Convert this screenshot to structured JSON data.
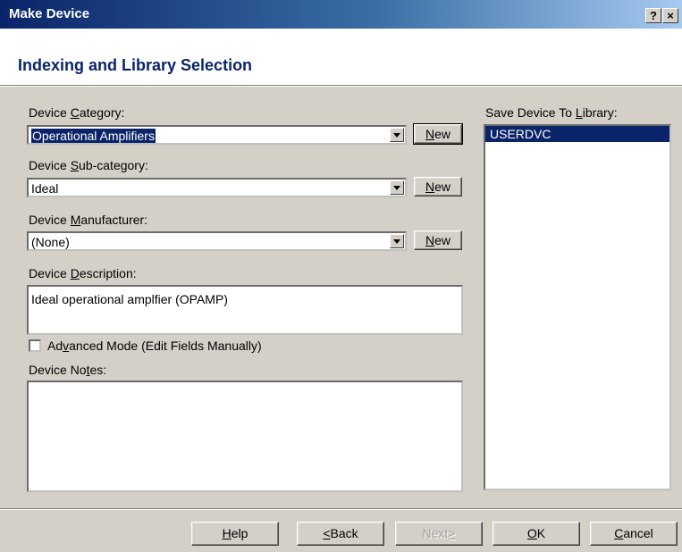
{
  "window": {
    "title": "Make Device",
    "help_btn": "?",
    "close_btn": "×"
  },
  "header": {
    "title": "Indexing and Library Selection"
  },
  "category": {
    "label": "Device Category:",
    "value": "Operational Amplifiers",
    "new_label": "New"
  },
  "subcategory": {
    "label": "Device Sub-category:",
    "value": "Ideal",
    "new_label": "New"
  },
  "manufacturer": {
    "label": "Device Manufacturer:",
    "value": "(None)",
    "new_label": "New"
  },
  "description": {
    "label": "Device Description:",
    "value": "Ideal operational amplfier (OPAMP)"
  },
  "advanced": {
    "label": "Advanced Mode (Edit Fields Manually)",
    "checked": false
  },
  "notes": {
    "label": "Device Notes:",
    "value": ""
  },
  "library": {
    "label": "Save Device To Library:",
    "items": [
      "USERDVC"
    ]
  },
  "buttons": {
    "help": "Help",
    "back": "<Back",
    "next": "Next>",
    "ok": "OK",
    "cancel": "Cancel"
  },
  "colors": {
    "title_bar": "#0a246a",
    "header_text": "#0a246a",
    "selection": "#0a246a",
    "dialog_bg": "#d4d0c8"
  }
}
